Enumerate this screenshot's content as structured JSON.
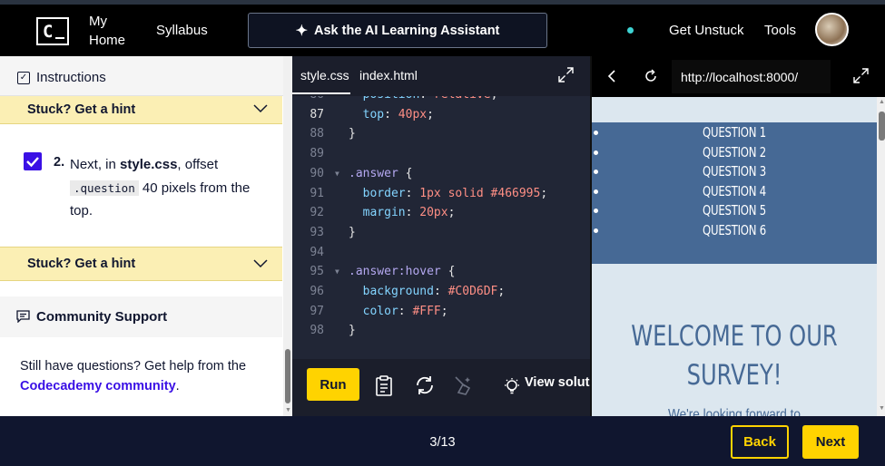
{
  "header": {
    "logo_letter": "C",
    "my_home_line1": "My",
    "my_home_line2": "Home",
    "syllabus": "Syllabus",
    "ai_assistant": "Ask the AI Learning Assistant",
    "get_unstuck": "Get Unstuck",
    "tools": "Tools",
    "status_dot_color": "#3ed3d3"
  },
  "instructions": {
    "title": "Instructions",
    "hint_label": "Stuck? Get a hint",
    "task_number": "2.",
    "task_prefix": "Next, in ",
    "task_file": "style.css",
    "task_mid": ", offset",
    "task_code": ".question",
    "task_suffix": " 40 pixels from the top.",
    "hint2_label": "Stuck? Get a hint",
    "community_title": "Community Support",
    "still_text": "Still have questions? Get help from the ",
    "community_link": "Codecademy community",
    "period": "."
  },
  "editor": {
    "tabs": [
      "style.css",
      "index.html"
    ],
    "active_tab": "style.css",
    "lines": [
      {
        "num": "86",
        "text": "  position: relative;"
      },
      {
        "num": "87",
        "text": "  top: 40px;"
      },
      {
        "num": "88",
        "text": "}"
      },
      {
        "num": "89",
        "text": ""
      },
      {
        "num": "90",
        "text": ".answer {"
      },
      {
        "num": "91",
        "text": "  border: 1px solid #466995;"
      },
      {
        "num": "92",
        "text": "  margin: 20px;"
      },
      {
        "num": "93",
        "text": "}"
      },
      {
        "num": "94",
        "text": ""
      },
      {
        "num": "95",
        "text": ".answer:hover {"
      },
      {
        "num": "96",
        "text": "  background: #C0D6DF;"
      },
      {
        "num": "97",
        "text": "  color: #FFF;"
      },
      {
        "num": "98",
        "text": "}"
      }
    ],
    "run": "Run",
    "view_solution": "View soluti"
  },
  "browser": {
    "url": "http://localhost:8000/",
    "questions": [
      "QUESTION 1",
      "QUESTION 2",
      "QUESTION 3",
      "QUESTION 4",
      "QUESTION 5",
      "QUESTION 6"
    ],
    "welcome_line1": "WELCOME TO OUR",
    "welcome_line2": "SURVEY!",
    "looking": "We're looking forward to",
    "question_bg": "#466995",
    "page_bg": "#dce7ef"
  },
  "footer": {
    "progress": "3/13",
    "back": "Back",
    "next": "Next",
    "accent": "#ffd300"
  }
}
